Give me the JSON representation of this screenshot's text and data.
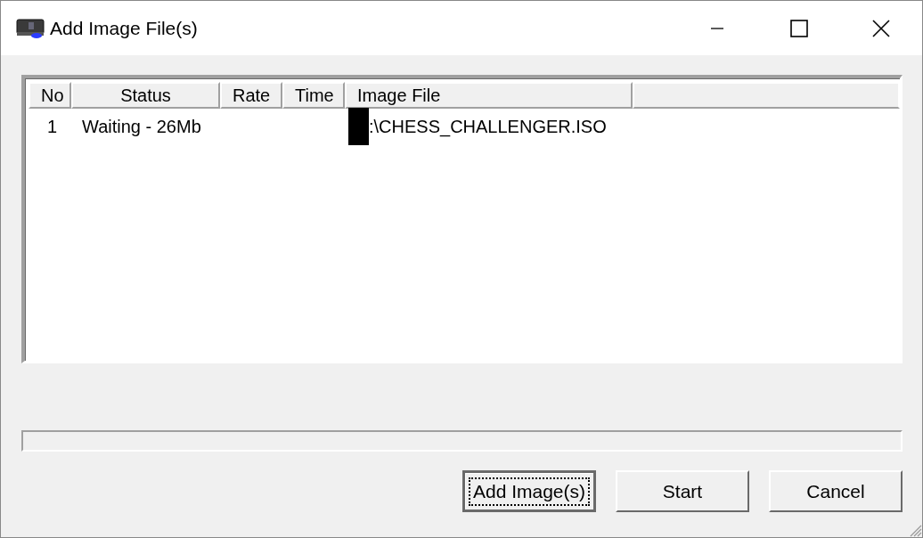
{
  "window": {
    "title": "Add Image File(s)"
  },
  "table": {
    "columns": [
      "No",
      "Status",
      "Rate",
      "Time",
      "Image File"
    ],
    "rows": [
      {
        "no": "1",
        "status": "Waiting - 26Mb",
        "image_file": ":\\CHESS_CHALLENGER.ISO",
        "redacted_prefix": true
      }
    ]
  },
  "progress": {
    "level": 0
  },
  "buttons": [
    {
      "label": "Add Image(s)",
      "focused": true
    },
    {
      "label": "Start",
      "focused": false
    },
    {
      "label": "Cancel",
      "focused": false
    }
  ]
}
